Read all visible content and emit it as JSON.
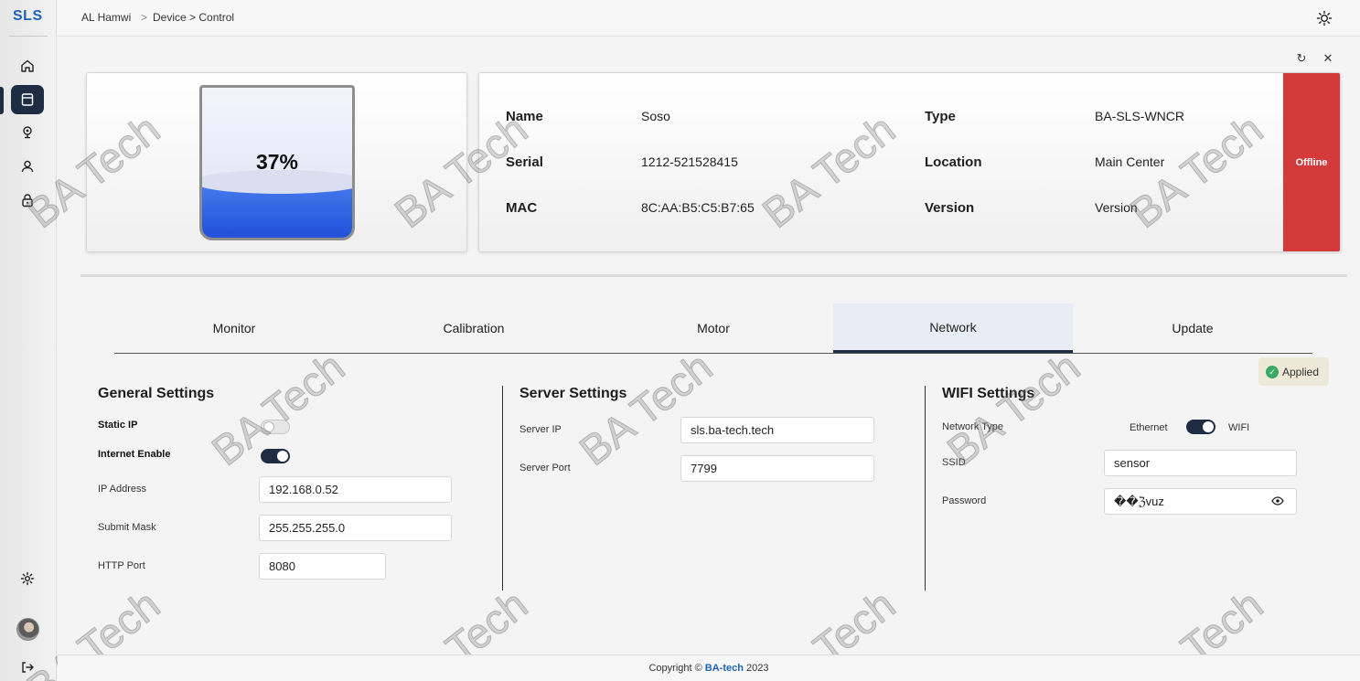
{
  "app": {
    "logo": "SLS"
  },
  "breadcrumb": {
    "home": "AL Hamwi",
    "separator": ">",
    "path": "Device > Control"
  },
  "sidebar": {
    "items": [
      {
        "name": "home-icon"
      },
      {
        "name": "device-icon",
        "active": true
      },
      {
        "name": "location-pin-icon"
      },
      {
        "name": "user-icon"
      },
      {
        "name": "lock-icon"
      }
    ],
    "bottom": [
      {
        "name": "gear-icon"
      },
      {
        "name": "avatar"
      },
      {
        "name": "logout-icon"
      }
    ]
  },
  "tank": {
    "level_percent": 37,
    "label": "37%"
  },
  "device": {
    "name_label": "Name",
    "name_value": "Soso",
    "serial_label": "Serial",
    "serial_value": "1212-521528415",
    "mac_label": "MAC",
    "mac_value": "8C:AA:B5:C5:B7:65",
    "type_label": "Type",
    "type_value": "BA-SLS-WNCR",
    "location_label": "Location",
    "location_value": "Main Center",
    "version_label": "Version",
    "version_value": "Version",
    "status": "Offline"
  },
  "tabs": [
    "Monitor",
    "Calibration",
    "Motor",
    "Network",
    "Update"
  ],
  "active_tab": "Network",
  "applied_label": "Applied",
  "general": {
    "title": "General Settings",
    "static_ip_label": "Static IP",
    "static_ip_on": false,
    "internet_label": "Internet Enable",
    "internet_on": true,
    "ip_label": "IP Address",
    "ip_value": "192.168.0.52",
    "mask_label": "Submit Mask",
    "mask_value": "255.255.255.0",
    "port_label": "HTTP Port",
    "port_value": "8080"
  },
  "server": {
    "title": "Server Settings",
    "ip_label": "Server IP",
    "ip_value": "sls.ba-tech.tech",
    "port_label": "Server Port",
    "port_value": "7799"
  },
  "wifi": {
    "title": "WIFI Settings",
    "network_type_label": "Network Type",
    "ethernet_label": "Ethernet",
    "wifi_label": "WIFI",
    "wifi_selected": true,
    "ssid_label": "SSID",
    "ssid_value": "sensor",
    "password_label": "Password",
    "password_value": "��ℨvuz"
  },
  "watermark": "BA Tech",
  "footer": {
    "prefix": "Copyright ©",
    "brand": "BA-tech",
    "year": "2023"
  },
  "colors": {
    "accent": "#1f2d44",
    "offline": "#d43a3a",
    "tank_fill": "#2f63e6",
    "brand": "#1e63b8",
    "applied_check": "#3aa866"
  }
}
